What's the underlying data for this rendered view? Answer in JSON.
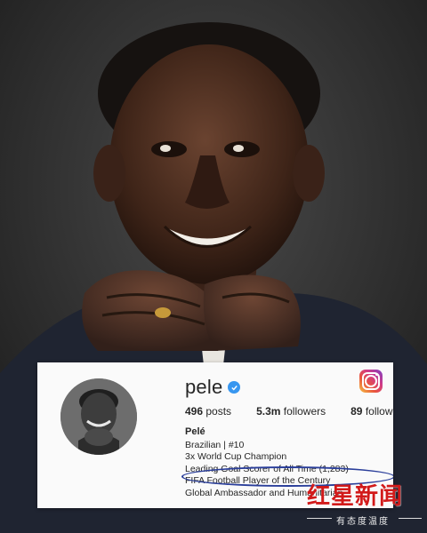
{
  "profile": {
    "username": "pele",
    "verified": true,
    "stats": {
      "posts": "496",
      "posts_label": "posts",
      "followers": "5.3m",
      "followers_label": "followers",
      "following": "89",
      "following_label": "following"
    },
    "bio": {
      "name": "Pelé",
      "line1": "Brazilian | #10",
      "line2": "3x World Cup Champion",
      "line3": "Leading Goal Scorer of All Time (1,283)",
      "line4": "FIFA Football Player of the Century",
      "line5": "Global Ambassador and Humanitarian"
    }
  },
  "watermark": {
    "title": "红星新闻",
    "subtitle": "有态度温度"
  },
  "colors": {
    "verified_badge": "#3897f0",
    "highlight_ellipse": "#2a3e9a",
    "watermark_red": "#d21a1a",
    "card_bg": "#fafafa"
  },
  "icons": [
    "instagram-logo-icon",
    "verified-badge-icon"
  ]
}
